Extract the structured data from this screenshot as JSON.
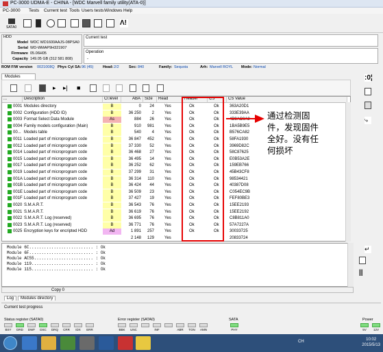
{
  "window": {
    "title": "PC-3000 UDMA-E - CHINA - [WDC Marvell family utility(ATA-0)]"
  },
  "menu": [
    "PC-3000",
    "Tests",
    "Current test",
    "Tools",
    "Users tests",
    "Windows",
    "Help"
  ],
  "toolbar": {
    "sata_label": "SATA0"
  },
  "hdd": {
    "section": "HDD",
    "model_label": "Model",
    "model": "WDC WD1600AAJS-08PSA0",
    "serial_label": "Serial",
    "serial": "WD-WMAP9H321907",
    "firmware_label": "Firmware",
    "firmware": "05.06H05",
    "capacity_label": "Capacity",
    "capacity": "149.05 GB (312 581 808)"
  },
  "current_test": {
    "label": "Current test"
  },
  "operation": {
    "label": "Operation",
    "value": "-"
  },
  "fw": {
    "label": "ROM F/W version",
    "version": "0021008Q",
    "phys_label": "Phys",
    "cyl_sa_label": "Cyl SA:",
    "cyl_sa": "96 (45)",
    "head_label": "Head:",
    "head": "2/2",
    "sec_label": "Sec:",
    "sec": "840",
    "family_label": "Family:",
    "family": "Sequoia",
    "arh_label": "Arh:",
    "arh": "Marvell ROYL",
    "mode_label": "Mode:",
    "mode": "Normal"
  },
  "modules_tab": "Modules",
  "table": {
    "headers": {
      "id": "...",
      "desc": "Description",
      "level": "Cr.level",
      "aba": "ABA",
      "size": "Size",
      "read": "Read",
      "header": "Header",
      "cs": "CS",
      "csval": "CS Value"
    },
    "rows": [
      {
        "id": "0001",
        "desc": "Modules directory",
        "level": "B",
        "aba": "0",
        "size": "24",
        "read": "Yes",
        "header": "Ok",
        "cs": "Ok",
        "csval": "363A20D1"
      },
      {
        "id": "0002",
        "desc": "Configuration (HDD ID)",
        "level": "B",
        "aba": "36 250",
        "size": "2",
        "read": "Yes",
        "header": "Ok",
        "cs": "Ok",
        "csval": "333E39AA"
      },
      {
        "id": "0003",
        "desc": "Format Select Data Module",
        "level": "As",
        "aba": "884",
        "size": "26",
        "read": "Yes",
        "header": "Ok",
        "cs": "Ok",
        "csval": "4B9AC0A9"
      },
      {
        "id": "0004",
        "desc": "Family models configuration (Main)",
        "level": "B",
        "aba": "910",
        "size": "981",
        "read": "Yes",
        "header": "Ok",
        "cs": "Ok",
        "csval": "1BA5B9E5"
      },
      {
        "id": "00...",
        "desc": "Models table",
        "level": "B",
        "aba": "540",
        "size": "4",
        "read": "Yes",
        "header": "Ok",
        "cs": "Ok",
        "csval": "B576CA82"
      },
      {
        "id": "0011",
        "desc": "Loaded part of microprogram code",
        "level": "B",
        "aba": "36 847",
        "size": "452",
        "read": "Yes",
        "header": "Ok",
        "cs": "Ok",
        "csval": "58FA1930"
      },
      {
        "id": "0012",
        "desc": "Loaded part of microprogram code",
        "level": "B",
        "aba": "37 330",
        "size": "52",
        "read": "Yes",
        "header": "Ok",
        "cs": "Ok",
        "csval": "3969D82C"
      },
      {
        "id": "0014",
        "desc": "Loaded part of microprogram code",
        "level": "B",
        "aba": "36 468",
        "size": "27",
        "read": "Yes",
        "header": "Ok",
        "cs": "Ok",
        "csval": "58C87625"
      },
      {
        "id": "0015",
        "desc": "Loaded part of microprogram code",
        "level": "B",
        "aba": "36 495",
        "size": "14",
        "read": "Yes",
        "header": "Ok",
        "cs": "Ok",
        "csval": "E0B53A2E"
      },
      {
        "id": "0017",
        "desc": "Loaded part of microprogram code",
        "level": "B",
        "aba": "36 252",
        "size": "62",
        "read": "Yes",
        "header": "Ok",
        "cs": "Ok",
        "csval": "159EB766"
      },
      {
        "id": "0019",
        "desc": "Loaded part of microprogram code",
        "level": "B",
        "aba": "37 299",
        "size": "31",
        "read": "Yes",
        "header": "Ok",
        "cs": "Ok",
        "csval": "45B43CF8"
      },
      {
        "id": "001A",
        "desc": "Loaded part of microprogram code",
        "level": "B",
        "aba": "36 314",
        "size": "110",
        "read": "Yes",
        "header": "Ok",
        "cs": "Ok",
        "csval": "98534421"
      },
      {
        "id": "001B",
        "desc": "Loaded part of microprogram code",
        "level": "B",
        "aba": "36 424",
        "size": "44",
        "read": "Yes",
        "header": "Ok",
        "cs": "Ok",
        "csval": "40387D08"
      },
      {
        "id": "001E",
        "desc": "Loaded part of microprogram code",
        "level": "B",
        "aba": "36 509",
        "size": "23",
        "read": "Yes",
        "header": "Ok",
        "cs": "Ok",
        "csval": "C054EC9B"
      },
      {
        "id": "001F",
        "desc": "Loaded part of microprogram code",
        "level": "B",
        "aba": "37 427",
        "size": "19",
        "read": "Yes",
        "header": "Ok",
        "cs": "Ok",
        "csval": "FEF80BE3"
      },
      {
        "id": "0020",
        "desc": "S.M.A.R.T.",
        "level": "B",
        "aba": "36 543",
        "size": "76",
        "read": "Yes",
        "header": "Ok",
        "cs": "Ok",
        "csval": "15EE2193"
      },
      {
        "id": "0021",
        "desc": "S.M.A.R.T.",
        "level": "B",
        "aba": "36 619",
        "size": "76",
        "read": "Yes",
        "header": "Ok",
        "cs": "Ok",
        "csval": "15EE2192"
      },
      {
        "id": "0022",
        "desc": "S.M.A.R.T. Log (reserved)",
        "level": "B",
        "aba": "36 695",
        "size": "76",
        "read": "Yes",
        "header": "Ok",
        "cs": "Ok",
        "csval": "C8B811A0"
      },
      {
        "id": "0023",
        "desc": "S.M.A.R.T. Log (reserved)",
        "level": "B",
        "aba": "36 771",
        "size": "76",
        "read": "Yes",
        "header": "Ok",
        "cs": "Ok",
        "csval": "57A7227A"
      },
      {
        "id": "0025",
        "desc": "Encryption keys for encripted HDD",
        "level": "Ad",
        "aba": "1 891",
        "size": "257",
        "read": "Yes",
        "header": "Ok",
        "cs": "Ok",
        "csval": "30033725"
      },
      {
        "id": "",
        "desc": "",
        "level": "",
        "aba": "2 148",
        "size": "129",
        "read": "Yes",
        "header": "",
        "cs": "",
        "csval": "20833724"
      }
    ]
  },
  "annotation": {
    "line1": "通过检测固",
    "line2": "件，发现固件",
    "line3": "全好。没有任",
    "line4": "何损坏"
  },
  "log": [
    "Module 6C.......................... : Ok",
    "Module 6F.......................... : Ok",
    "Module AC55........................ : Ok",
    "Module 119......................... : Ok",
    "Module 115......................... : Ok"
  ],
  "copy_label": "Copy 0",
  "bottom_tabs": [
    "Log",
    "Modules directory"
  ],
  "current_test_progress": "Current test progress",
  "status": {
    "sata_label": "Status register (SATA0)",
    "status_leds": [
      "BSY",
      "DRD",
      "DWF",
      "DSC",
      "DRQ",
      "CRR",
      "IDX",
      "ERR"
    ],
    "error_label": "Error register (SATA0)",
    "error_leds": [
      "BBK",
      "UNC",
      "",
      "INF",
      "",
      "ABR",
      "TON",
      "AMN"
    ],
    "sata2_label": "SATA",
    "sata2_leds": [
      "PHY"
    ],
    "power_label": "Power",
    "power_leds": [
      "5V",
      "12V"
    ]
  },
  "taskbar": {
    "tray": "CH",
    "time": "10:02",
    "date": "2015/5/13"
  }
}
